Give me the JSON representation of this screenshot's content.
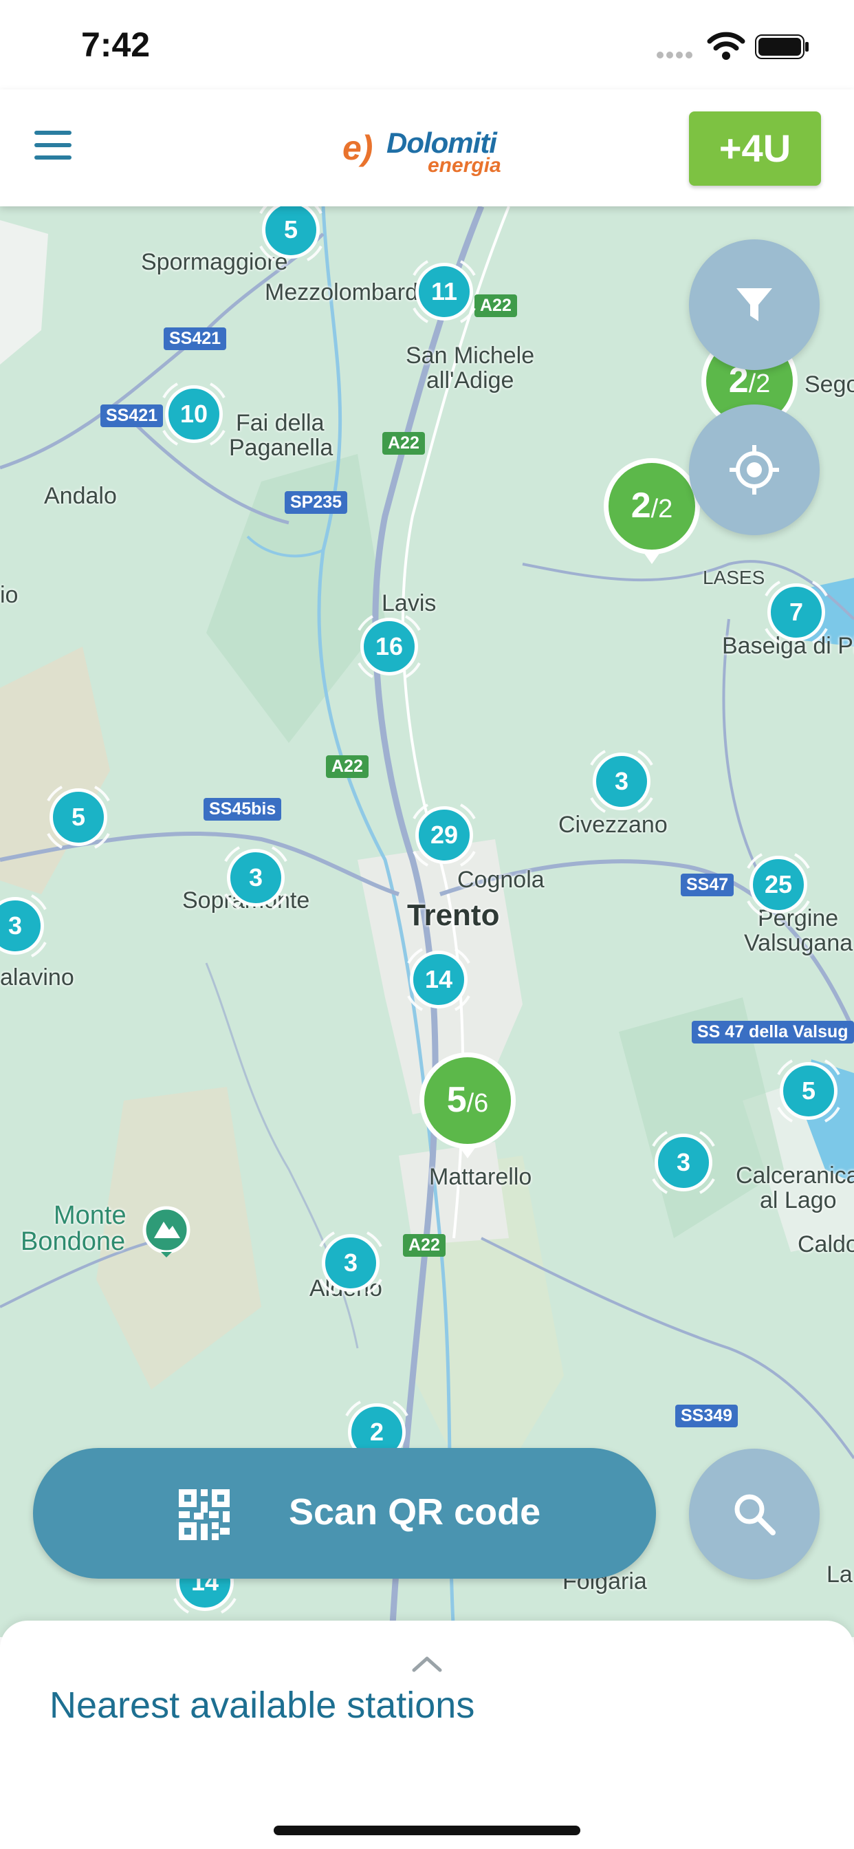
{
  "status_bar": {
    "time": "7:42"
  },
  "header": {
    "logo": {
      "mark": "e)",
      "name": "Dolomiti",
      "sub": "energia"
    },
    "plus_button_label": "+4U"
  },
  "map": {
    "places": [
      {
        "id": "spormaggiore",
        "label": "Spormaggiore"
      },
      {
        "id": "mezzolombardo",
        "label": "Mezzolombardo"
      },
      {
        "id": "san-michele",
        "label": "San Michele"
      },
      {
        "id": "all-adige",
        "label": "all'Adige"
      },
      {
        "id": "fai",
        "label": "Fai della"
      },
      {
        "id": "paganella",
        "label": "Paganella"
      },
      {
        "id": "andalo",
        "label": "Andalo"
      },
      {
        "id": "lavis",
        "label": "Lavis"
      },
      {
        "id": "lases",
        "label": "LASES"
      },
      {
        "id": "baselga",
        "label": "Baselga di Pinè"
      },
      {
        "id": "civezzano",
        "label": "Civezzano"
      },
      {
        "id": "cognola",
        "label": "Cognola"
      },
      {
        "id": "trento",
        "label": "Trento"
      },
      {
        "id": "sopramonte",
        "label": "Sopramonte"
      },
      {
        "id": "pergine",
        "label": "Pergine"
      },
      {
        "id": "valsugana",
        "label": "Valsugana"
      },
      {
        "id": "calavino",
        "label": "alavino"
      },
      {
        "id": "mattarello",
        "label": "Mattarello"
      },
      {
        "id": "calceranica",
        "label": "Calceranica"
      },
      {
        "id": "al-lago",
        "label": "al Lago"
      },
      {
        "id": "caldonazzo",
        "label": "Caldo"
      },
      {
        "id": "monte",
        "label": "Monte"
      },
      {
        "id": "bondone",
        "label": "Bondone"
      },
      {
        "id": "aldeno",
        "label": "Aldeno"
      },
      {
        "id": "folgaria",
        "label": "Folgaria"
      },
      {
        "id": "lavarone",
        "label": "La"
      },
      {
        "id": "segonzano",
        "label": "Segon"
      },
      {
        "id": "o-left",
        "label": "io"
      }
    ],
    "roads": [
      {
        "id": "ss421a",
        "label": "SS421",
        "color": "blue"
      },
      {
        "id": "ss421b",
        "label": "SS421",
        "color": "blue"
      },
      {
        "id": "a22a",
        "label": "A22",
        "color": "green"
      },
      {
        "id": "a22b",
        "label": "A22",
        "color": "green"
      },
      {
        "id": "a22c",
        "label": "A22",
        "color": "green"
      },
      {
        "id": "a22d",
        "label": "A22",
        "color": "green"
      },
      {
        "id": "sp235",
        "label": "SP235",
        "color": "blue"
      },
      {
        "id": "ss45bis",
        "label": "SS45bis",
        "color": "blue"
      },
      {
        "id": "ss47",
        "label": "SS47",
        "color": "blue"
      },
      {
        "id": "ss47long",
        "label": "SS 47 della Valsug",
        "color": "blue"
      },
      {
        "id": "ss349",
        "label": "SS349",
        "color": "blue"
      }
    ],
    "clusters": [
      {
        "count": "5"
      },
      {
        "count": "11"
      },
      {
        "count": "10"
      },
      {
        "count": "16"
      },
      {
        "count": "7"
      },
      {
        "count": "3"
      },
      {
        "count": "5"
      },
      {
        "count": "29"
      },
      {
        "count": "3"
      },
      {
        "count": "25"
      },
      {
        "count": "3"
      },
      {
        "count": "14"
      },
      {
        "count": "5"
      },
      {
        "count": "3"
      },
      {
        "count": "3"
      },
      {
        "count": "2"
      },
      {
        "count": "14"
      }
    ],
    "stations": [
      {
        "available": "2",
        "total": "/2"
      },
      {
        "available": "2",
        "total": "/2"
      },
      {
        "available": "5",
        "total": "/6"
      }
    ]
  },
  "scan_button": {
    "label": "Scan QR code"
  },
  "sheet": {
    "title": "Nearest available stations"
  },
  "colors": {
    "cluster": "#1bb3c6",
    "station": "#5cb84a",
    "primary": "#4a94b0",
    "accent": "#7dc242",
    "title": "#1d6f91"
  }
}
